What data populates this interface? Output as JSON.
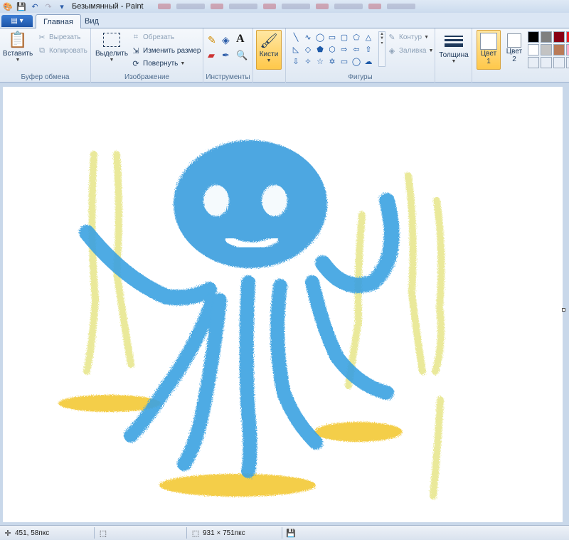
{
  "window": {
    "title": "Безымянный - Paint"
  },
  "tabs": {
    "file": "▤ ▾",
    "home": "Главная",
    "view": "Вид"
  },
  "clipboard": {
    "paste": "Вставить",
    "cut": "Вырезать",
    "copy": "Копировать",
    "label": "Буфер обмена"
  },
  "image": {
    "select": "Выделить",
    "crop": "Обрезать",
    "resize": "Изменить размер",
    "rotate": "Повернуть",
    "label": "Изображение"
  },
  "tools": {
    "label": "Инструменты"
  },
  "brushes": {
    "label": "Кисти"
  },
  "shapes": {
    "outline": "Контур",
    "fill": "Заливка",
    "label": "Фигуры"
  },
  "size": {
    "label": "Толщина"
  },
  "colors": {
    "color1": "Цвет 1",
    "color2": "Цвет 2",
    "color1_line1": "Цвет",
    "color1_line2": "1",
    "color2_line1": "Цвет",
    "color2_line2": "2",
    "swatches": [
      "#000000",
      "#7f7f7f",
      "#880015",
      "#ffffff",
      "#c3c3c3",
      "#b97a57",
      "#ffffff",
      "#ffffff"
    ]
  },
  "status": {
    "cursor": "451, 58пкс",
    "canvas_size": "931 × 751пкс"
  }
}
